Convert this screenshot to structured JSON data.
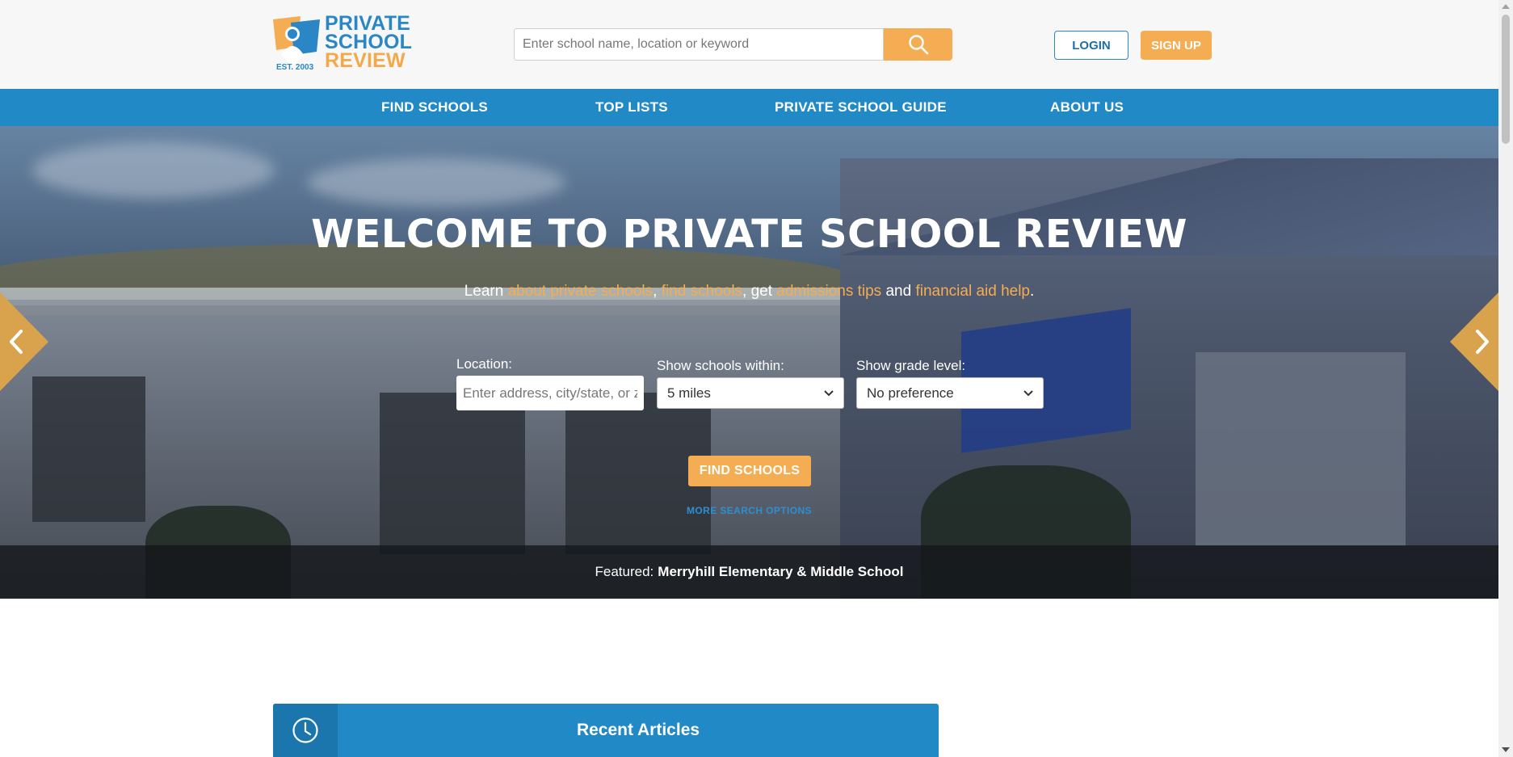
{
  "header": {
    "logo": {
      "line1": "PRIVATE",
      "line2": "SCHOOL",
      "line3": "REVIEW",
      "est": "EST. 2003"
    },
    "search": {
      "placeholder": "Enter school name, location or keyword",
      "icon": "search-icon"
    },
    "login_label": "LOGIN",
    "signup_label": "SIGN UP"
  },
  "nav": {
    "items": [
      {
        "label": "FIND SCHOOLS"
      },
      {
        "label": "TOP LISTS"
      },
      {
        "label": "PRIVATE SCHOOL GUIDE"
      },
      {
        "label": "ABOUT US"
      }
    ]
  },
  "hero": {
    "title": "WELCOME TO PRIVATE SCHOOL REVIEW",
    "subtitle": {
      "prefix": "Learn ",
      "link1": "about private schools",
      "sep1": ", ",
      "link2": "find schools",
      "sep2": ", get ",
      "link3": "admissions tips",
      "sep3": " and ",
      "link4": "financial aid help",
      "suffix": "."
    },
    "location_label": "Location:",
    "location_placeholder": "Enter address, city/state, or zip",
    "within_label": "Show schools within:",
    "within_value": "5 miles",
    "grade_label": "Show grade level:",
    "grade_value": "No preference",
    "find_button": "FIND SCHOOLS",
    "more_options": "MORE SEARCH OPTIONS",
    "featured_prefix": "Featured:",
    "featured_school": "Merryhill Elementary & Middle School",
    "prev_icon": "chevron-left-icon",
    "next_icon": "chevron-right-icon"
  },
  "articles": {
    "title": "Recent Articles",
    "icon": "clock-icon"
  },
  "colors": {
    "brand_blue": "#2089c6",
    "brand_orange": "#f4ad52"
  }
}
